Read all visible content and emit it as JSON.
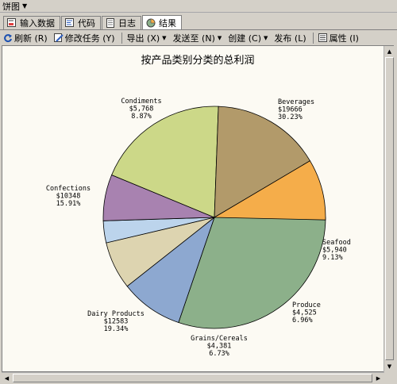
{
  "window": {
    "title": "饼图"
  },
  "tabs": [
    {
      "label": "输入数据",
      "icon": "input-data-icon"
    },
    {
      "label": "代码",
      "icon": "code-icon"
    },
    {
      "label": "日志",
      "icon": "log-icon"
    },
    {
      "label": "结果",
      "icon": "results-icon"
    }
  ],
  "toolbar": {
    "refresh": "刷新 (R)",
    "modify": "修改任务 (Y)",
    "export": "导出 (X)",
    "send_to": "发送至 (N)",
    "create": "创建 (C)",
    "publish": "发布 (L)",
    "properties": "属性 (I)"
  },
  "colors": {
    "Beverages": "#8cb08a",
    "Seafood": "#8da8d0",
    "Produce": "#ddd4b0",
    "Grains/Cereals": "#bcd4ec",
    "Meat/Poultry": "#a882b0",
    "Dairy Products": "#ccd888",
    "Confections": "#b29a6a",
    "Condiments": "#f5ad4a"
  },
  "chart_data": {
    "type": "pie",
    "title": "按产品类别分类的总利润",
    "slices": [
      {
        "category": "Beverages",
        "value_label": "$19666",
        "percent_label": "30.23%",
        "percent": 30.23
      },
      {
        "category": "Seafood",
        "value_label": "$5,940",
        "percent_label": "9.13%",
        "percent": 9.13
      },
      {
        "category": "Produce",
        "value_label": "$4,525",
        "percent_label": "6.96%",
        "percent": 6.96
      },
      {
        "category": "",
        "value_label": "",
        "percent_label": "",
        "percent": 3.19
      },
      {
        "category": "Grains/Cereals",
        "value_label": "$4,381",
        "percent_label": "6.73%",
        "percent": 6.73
      },
      {
        "category": "Dairy Products",
        "value_label": "$12583",
        "percent_label": "19.34%",
        "percent": 19.34
      },
      {
        "category": "Confections",
        "value_label": "$10348",
        "percent_label": "15.91%",
        "percent": 15.91
      },
      {
        "category": "Condiments",
        "value_label": "$5,768",
        "percent_label": "8.87%",
        "percent": 8.87
      }
    ],
    "slice_colors": [
      "#8cb08a",
      "#8da8d0",
      "#ddd4b0",
      "#bcd4ec",
      "#a882b0",
      "#ccd888",
      "#b29a6a",
      "#f5ad4a"
    ]
  }
}
